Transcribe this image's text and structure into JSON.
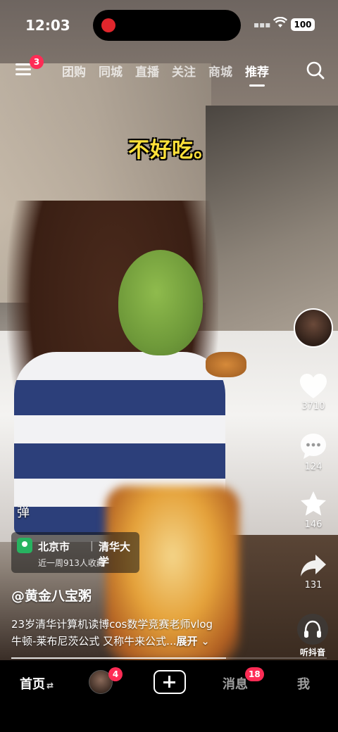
{
  "status_bar": {
    "time": "12:03",
    "battery": "100"
  },
  "top_nav": {
    "menu_badge": "3",
    "tabs": [
      {
        "label": "团购"
      },
      {
        "label": "同城"
      },
      {
        "label": "直播"
      },
      {
        "label": "关注"
      },
      {
        "label": "商城"
      },
      {
        "label": "推荐",
        "active": true
      }
    ]
  },
  "video": {
    "subtitle": "不好吃。",
    "danmu_toggle": "弹"
  },
  "right_rail": {
    "like_count": "3710",
    "comment_count": "124",
    "favorite_count": "146",
    "share_count": "131",
    "listen_label": "听抖音"
  },
  "location": {
    "city": "北京市",
    "place": "清华大学",
    "sub": "近一周913人收藏"
  },
  "post": {
    "author": "@黄金八宝粥",
    "desc_line1": "23岁清华计算机读博cos数学竞赛老师vlog",
    "desc_line2": "牛顿-莱布尼茨公式 又称牛来公式...",
    "expand": "展开"
  },
  "progress": {
    "fraction": 0.68
  },
  "bottom_nav": {
    "home": "首页",
    "friends_badge": "4",
    "messages": "消息",
    "messages_badge": "18",
    "me": "我"
  },
  "colors": {
    "accent": "#fe2c55",
    "subtitle": "#ffe13a",
    "location_pin": "#27b360"
  }
}
